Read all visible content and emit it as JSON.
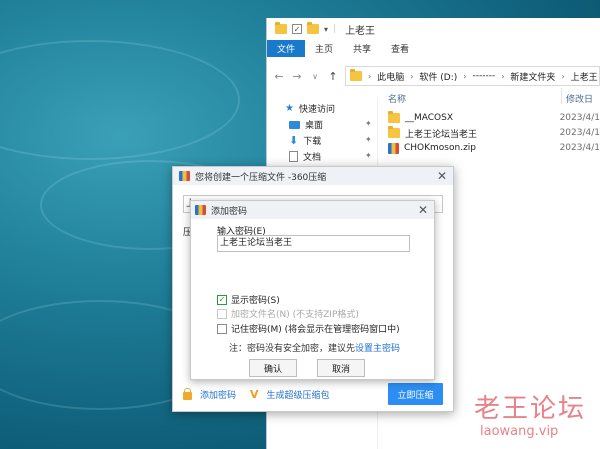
{
  "explorer": {
    "title": "上老王",
    "ribbon_tabs": [
      "文件",
      "主页",
      "共享",
      "查看"
    ],
    "breadcrumb": [
      "此电脑",
      "软件 (D:)",
      "-------",
      "新建文件夹",
      "上老王"
    ],
    "quick_access_label": "快速访问",
    "nav_items": [
      "桌面",
      "下载",
      "文档"
    ],
    "columns": {
      "name": "名称",
      "date": "修改日"
    },
    "files": [
      {
        "name": "__MACOSX",
        "date": "2023/4/1",
        "type": "folder"
      },
      {
        "name": "上老王论坛当老王",
        "date": "2023/4/1",
        "type": "folder"
      },
      {
        "name": "CHOKmoson.zip",
        "date": "2023/4/1",
        "type": "zip"
      }
    ]
  },
  "dialog360": {
    "title": "您将创建一个压缩文件 -360压缩",
    "path_value": "上",
    "compress_label": "压",
    "footer_password": "添加密码",
    "footer_super": "生成超级压缩包",
    "compress_button": "立即压缩"
  },
  "password_dialog": {
    "title": "添加密码",
    "input_label": "输入密码(E)",
    "input_value": "上老王论坛当老王",
    "show_password": "显示密码(S)",
    "encrypt_names": "加密文件名(N) (不支持ZIP格式)",
    "remember_password": "记住密码(M) (将会显示在管理密码窗口中)",
    "note_prefix": "注：密码没有安全加密，建议先",
    "note_link": "设置主密码",
    "ok_button": "确认",
    "cancel_button": "取消"
  },
  "watermark": {
    "big": "老王论坛",
    "small": "laowang.vip"
  },
  "colors": {
    "accent": "#2c8ef5",
    "ribbon_active": "#1979ca",
    "watermark": "#e7828a"
  }
}
